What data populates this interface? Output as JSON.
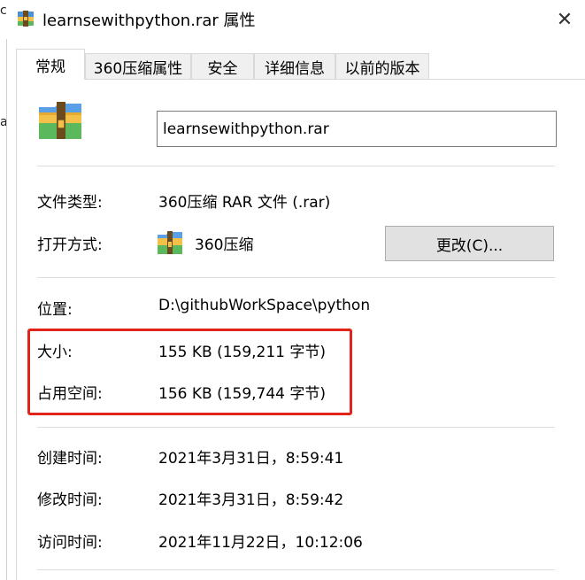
{
  "window": {
    "title": "learnsewithpython.rar 属性",
    "close_glyph": "✕",
    "edge_fragments": [
      "c",
      "a"
    ]
  },
  "tabs": [
    {
      "label": "常规",
      "active": true
    },
    {
      "label": "360压缩属性",
      "active": false
    },
    {
      "label": "安全",
      "active": false
    },
    {
      "label": "详细信息",
      "active": false
    },
    {
      "label": "以前的版本",
      "active": false
    }
  ],
  "general": {
    "file_name": "learnsewithpython.rar",
    "file_type_label": "文件类型:",
    "file_type_value": "360压缩 RAR 文件 (.rar)",
    "opens_with_label": "打开方式:",
    "opens_with_value": "360压缩",
    "change_button": "更改(C)...",
    "location_label": "位置:",
    "location_value": "D:\\githubWorkSpace\\python",
    "size_label": "大小:",
    "size_value": "155 KB (159,211 字节)",
    "size_on_disk_label": "占用空间:",
    "size_on_disk_value": "156 KB (159,744 字节)",
    "created_label": "创建时间:",
    "created_value": "2021年3月31日，8:59:41",
    "modified_label": "修改时间:",
    "modified_value": "2021年3月31日，8:59:42",
    "accessed_label": "访问时间:",
    "accessed_value": "2021年11月22日，10:12:06"
  },
  "colors": {
    "highlight": "#e2231a",
    "archive_body": "#4a90d9",
    "archive_band": "#f3c04a",
    "archive_green": "#5cb85c",
    "archive_strap": "#6b4a1e"
  }
}
